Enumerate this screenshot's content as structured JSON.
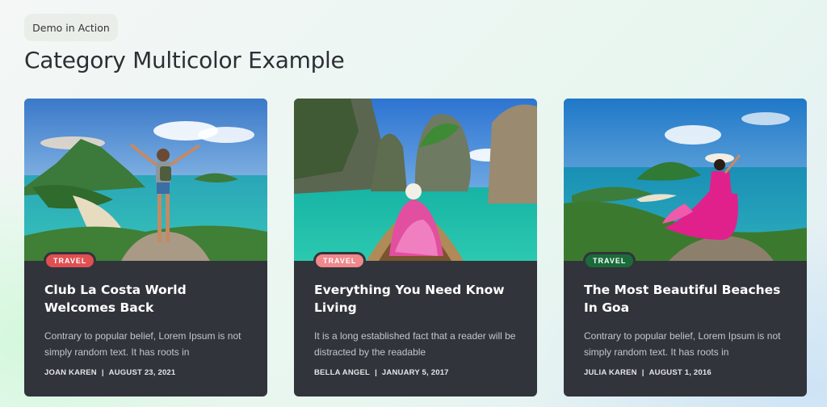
{
  "header": {
    "badge": "Demo in Action",
    "title": "Category Multicolor Example"
  },
  "cards": [
    {
      "tag": "TRAVEL",
      "tag_color": "#e04f52",
      "title": "Club La Costa World Welcomes Back",
      "excerpt": "Contrary to popular belief, Lorem Ipsum is not simply random text. It has roots in",
      "author": "JOAN KAREN",
      "date": "AUGUST 23, 2021",
      "image": "tropical-island-man-arms-raised"
    },
    {
      "tag": "TRAVEL",
      "tag_color": "#f0888c",
      "title": "Everything You Need Know Living",
      "excerpt": "It is a long established fact that a reader will be distracted by the readable",
      "author": "BELLA ANGEL",
      "date": "JANUARY 5, 2017",
      "image": "longtail-boat-woman-pink-dress-cliffs"
    },
    {
      "tag": "TRAVEL",
      "tag_color": "#1b6b3a",
      "title": "The Most Beautiful Beaches In Goa",
      "excerpt": "Contrary to popular belief, Lorem Ipsum is not simply random text. It has roots in",
      "author": "JULIA KAREN",
      "date": "AUGUST 1, 2016",
      "image": "woman-pink-dress-hat-bay-view"
    }
  ],
  "meta_separator": "|"
}
